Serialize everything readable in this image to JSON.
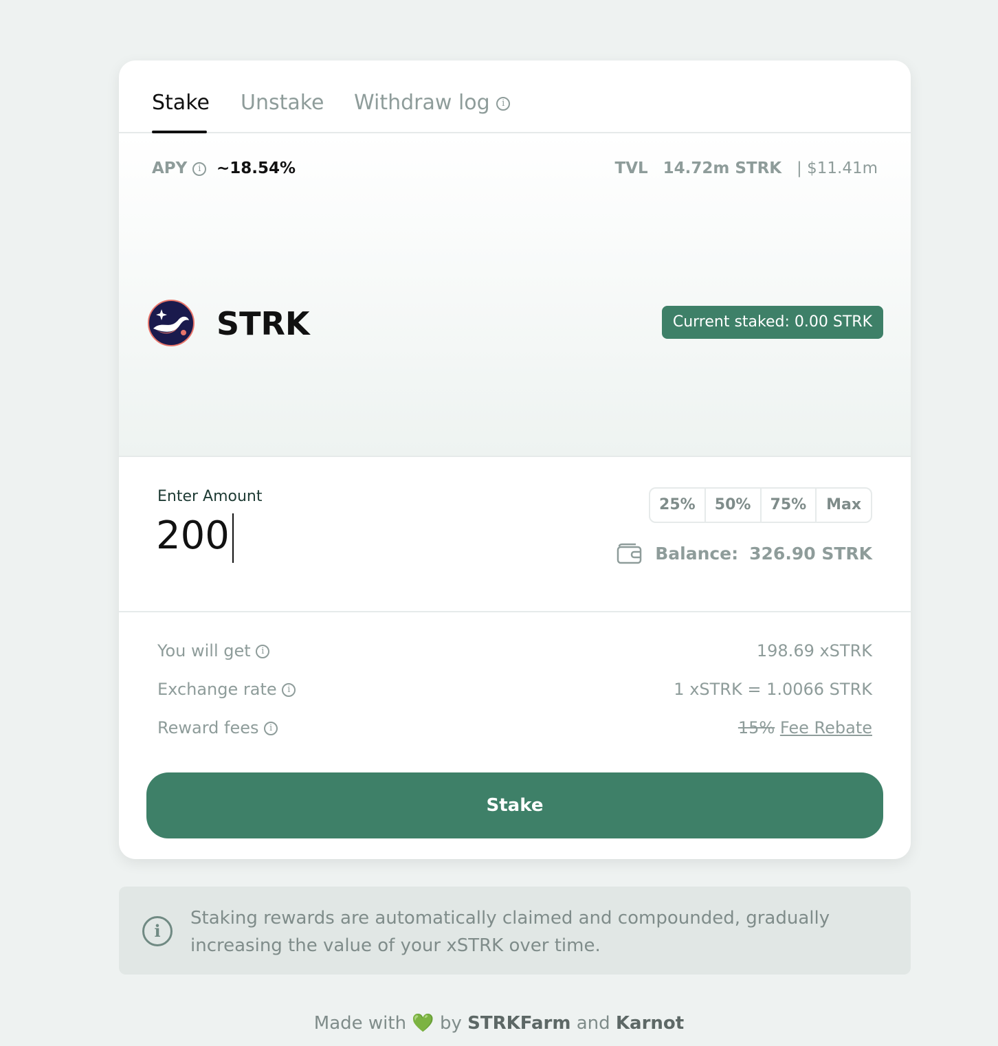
{
  "tabs": [
    {
      "label": "Stake"
    },
    {
      "label": "Unstake"
    },
    {
      "label": "Withdraw log"
    }
  ],
  "hero": {
    "apy_label": "APY",
    "apy_value": "~18.54%",
    "tvl_label": "TVL",
    "tvl_amount": "14.72m STRK",
    "tvl_usd": "| $11.41m",
    "token_name": "STRK",
    "current_staked": "Current staked: 0.00 STRK"
  },
  "amount": {
    "label": "Enter Amount",
    "value": "200",
    "percent_buttons": [
      "25%",
      "50%",
      "75%",
      "Max"
    ],
    "balance_label": "Balance:",
    "balance_value": "326.90 STRK"
  },
  "details": {
    "you_will_get_label": "You will get",
    "you_will_get_value": "198.69 xSTRK",
    "exchange_rate_label": "Exchange rate",
    "exchange_rate_value": "1 xSTRK = 1.0066 STRK",
    "reward_fees_label": "Reward fees",
    "reward_fees_old": "15%",
    "reward_fees_link": "Fee Rebate"
  },
  "stake_button": "Stake",
  "notice": "Staking rewards are automatically claimed and compounded, gradually increasing the value of your xSTRK over time.",
  "footer": {
    "made_with": "Made with",
    "heart": "💚",
    "by": "by",
    "brand1": "STRKFarm",
    "and": "and",
    "brand2": "Karnot"
  },
  "colors": {
    "accent": "#3e8068",
    "background": "#eef2f1",
    "muted_text": "#8e9c9a"
  },
  "icons": [
    "info-icon",
    "strk-logo-icon",
    "wallet-icon"
  ]
}
